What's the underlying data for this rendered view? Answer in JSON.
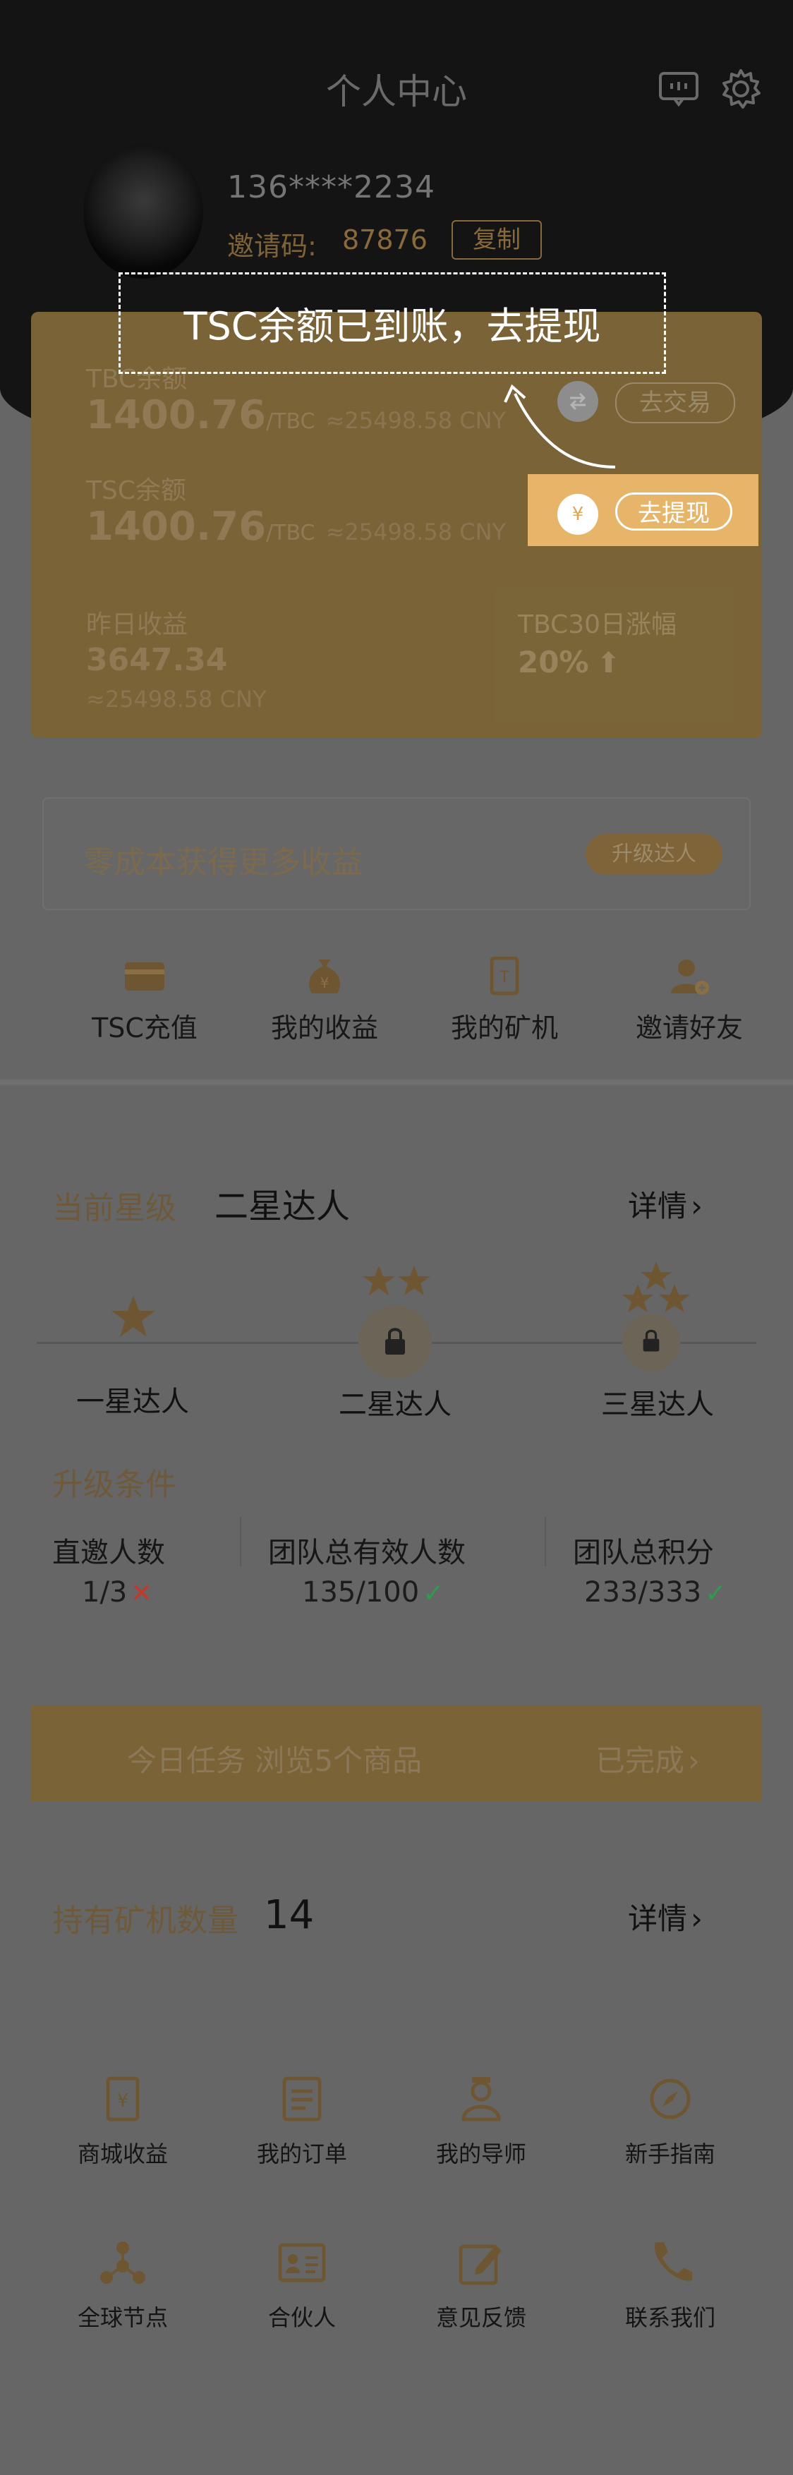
{
  "header": {
    "title": "个人中心",
    "message_icon": "chat-icon",
    "settings_icon": "gear-icon"
  },
  "user": {
    "phone": "136****2234",
    "invite_label": "邀请码:",
    "invite_code": "87876",
    "copy_label": "复制"
  },
  "tooltip": {
    "text": "TSC余额已到账，去提现"
  },
  "balances": {
    "tbc": {
      "label": "TBC余额",
      "amount": "1400.76",
      "unit": "/TBC",
      "approx": "≈25498.58 CNY",
      "action_icon": "exchange-icon",
      "action": "去交易"
    },
    "tsc": {
      "label": "TSC余额",
      "amount": "1400.76",
      "unit": "/TBC",
      "approx": "≈25498.58 CNY",
      "action_icon": "yen-icon",
      "action": "去提现"
    },
    "yesterday": {
      "label": "昨日收益",
      "amount": "3647.34",
      "approx": "≈25498.58 CNY"
    },
    "tbc30": {
      "label": "TBC30日涨幅",
      "value": "20%"
    }
  },
  "upgrade_banner": {
    "text": "零成本获得更多收益",
    "button": "升级达人"
  },
  "quick_actions": [
    {
      "label": "TSC充值",
      "icon": "card-icon"
    },
    {
      "label": "我的收益",
      "icon": "moneybag-icon"
    },
    {
      "label": "我的矿机",
      "icon": "miner-icon"
    },
    {
      "label": "邀请好友",
      "icon": "add-user-icon"
    }
  ],
  "star_level": {
    "label": "当前星级",
    "value": "二星达人",
    "detail": "详情",
    "levels": [
      {
        "label": "一星达人",
        "stars": 1
      },
      {
        "label": "二星达人",
        "stars": 2
      },
      {
        "label": "三星达人",
        "stars": 3
      }
    ],
    "conditions_title": "升级条件",
    "conditions": [
      {
        "label": "直邀人数",
        "value": "1/3",
        "status": "✕",
        "status_color": "#c0392b"
      },
      {
        "label": "团队总有效人数",
        "value": "135/100",
        "status": "✓",
        "status_color": "#2e9d4a"
      },
      {
        "label": "团队总积分",
        "value": "233/333",
        "status": "✓",
        "status_color": "#2e9d4a"
      }
    ]
  },
  "task": {
    "text": "今日任务 浏览5个商品",
    "status": "已完成"
  },
  "miners": {
    "label": "持有矿机数量",
    "count": "14",
    "detail": "详情"
  },
  "grid": [
    {
      "label": "商城收益",
      "icon": "receipt-icon"
    },
    {
      "label": "我的订单",
      "icon": "order-icon"
    },
    {
      "label": "我的导师",
      "icon": "mentor-icon"
    },
    {
      "label": "新手指南",
      "icon": "compass-icon"
    },
    {
      "label": "全球节点",
      "icon": "nodes-icon"
    },
    {
      "label": "合伙人",
      "icon": "id-card-icon"
    },
    {
      "label": "意见反馈",
      "icon": "edit-icon"
    },
    {
      "label": "联系我们",
      "icon": "phone-icon"
    }
  ],
  "colors": {
    "gold": "#e6b56a",
    "card_dim": "#7a6337",
    "header_dark": "#141414",
    "overlay": "#666666"
  }
}
